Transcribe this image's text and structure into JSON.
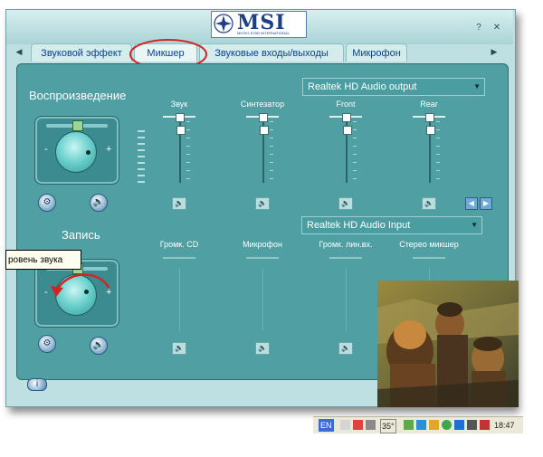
{
  "brand": {
    "logo_text": "MSI",
    "logo_sub": "MICRO-STAR INTERNATIONAL"
  },
  "window": {
    "help_button": "?",
    "close_button": "✕"
  },
  "tabs": [
    {
      "label": "Звуковой эффект",
      "active": false
    },
    {
      "label": "Микшер",
      "active": true
    },
    {
      "label": "Звуковые входы/выходы",
      "active": false
    },
    {
      "label": "Микрофон",
      "active": false
    }
  ],
  "tab_scroll": {
    "left": "◀",
    "right": "▶"
  },
  "playback": {
    "title": "Воспроизведение",
    "device": "Realtek HD Audio output",
    "knob_minus": "-",
    "knob_plus": "+",
    "channels": [
      {
        "label": "Звук",
        "level": 0.92
      },
      {
        "label": "Синтезатор",
        "level": 0.92
      },
      {
        "label": "Front",
        "level": 0.92
      },
      {
        "label": "Rear",
        "level": 0.92
      }
    ],
    "nav_prev": "◀",
    "nav_next": "▶"
  },
  "record": {
    "title": "Запись",
    "device": "Realtek HD Audio Input",
    "knob_minus": "-",
    "knob_plus": "+",
    "channels": [
      {
        "label": "Громк. CD"
      },
      {
        "label": "Микрофон"
      },
      {
        "label": "Громк. лин.вх."
      },
      {
        "label": "Стерео микшер"
      }
    ]
  },
  "tooltip": {
    "text": "ровень звука"
  },
  "info_button": "i",
  "taskbar": {
    "lang": "EN",
    "temp": "35°",
    "time": "18:47"
  },
  "colors": {
    "panel": "#4f9fa3",
    "tab_text": "#0c3f8b",
    "annotation": "#d32424"
  }
}
